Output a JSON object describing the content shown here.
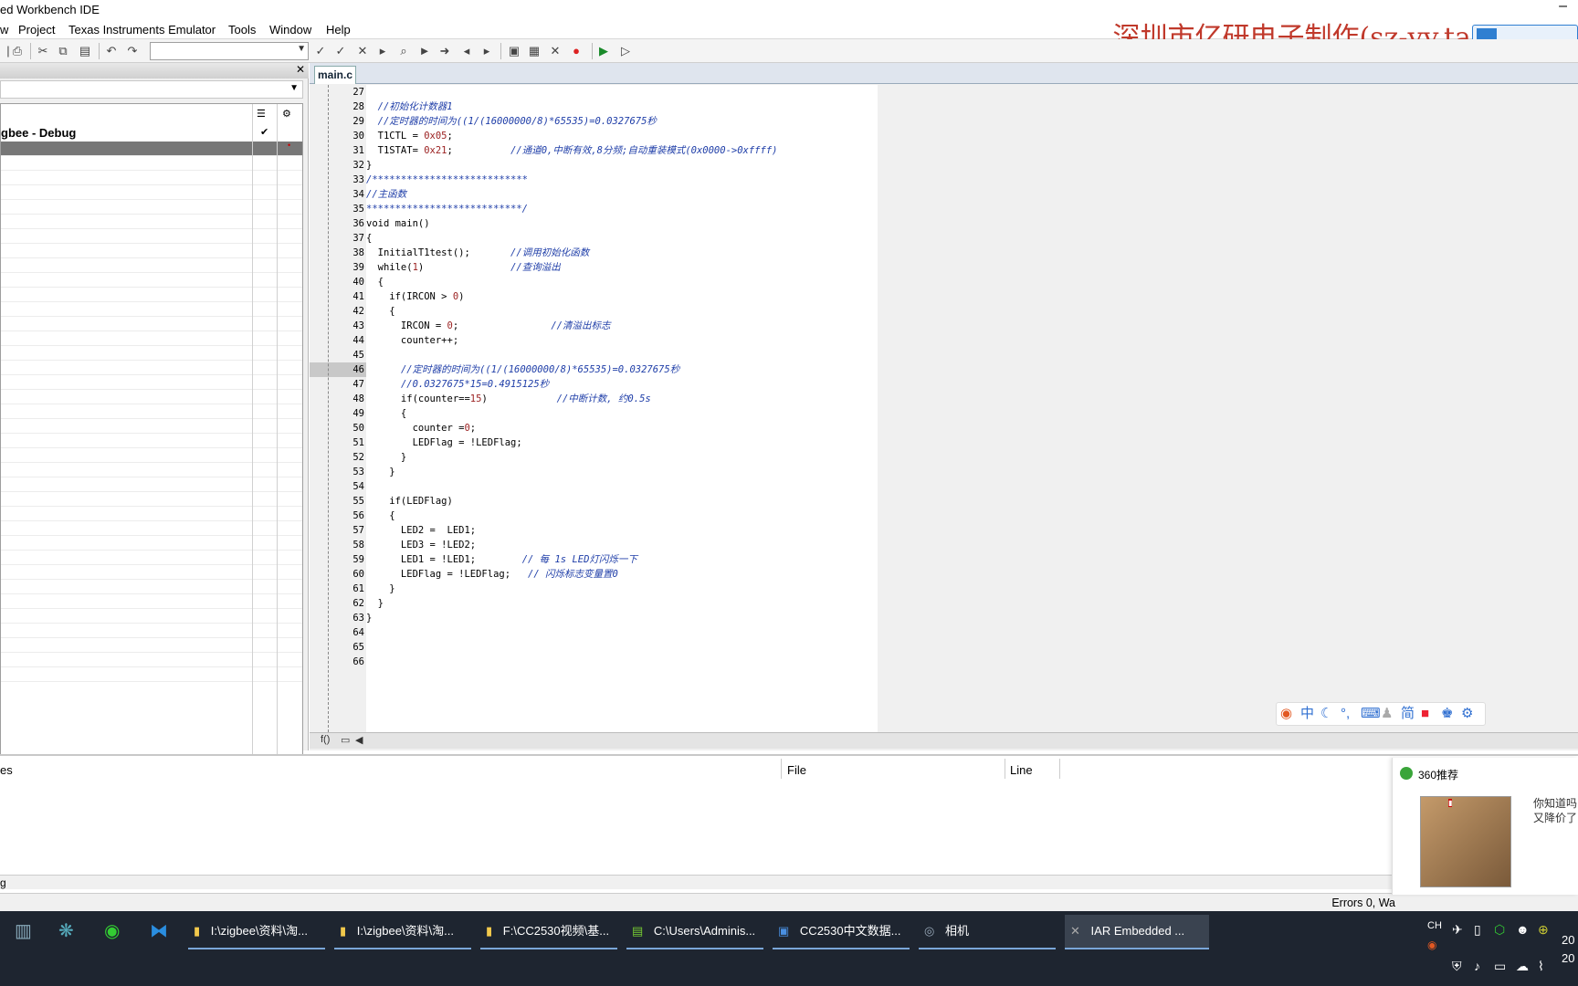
{
  "window": {
    "title": "ed Workbench IDE"
  },
  "menu": [
    "w",
    "Project",
    "Texas Instruments Emulator",
    "Tools",
    "Window",
    "Help"
  ],
  "watermark": "深圳市亿研电子制作(sz-yy.taobao.co",
  "workspace": {
    "project": "gbee - Debug",
    "check": "✔"
  },
  "editor": {
    "tab": "main.c",
    "lines": [
      {
        "n": "27",
        "code": ""
      },
      {
        "n": "28",
        "code": "  //初始化计数器1"
      },
      {
        "n": "29",
        "code": "  //定时器的时间为((1/(16000000/8)*65535)=0.0327675秒"
      },
      {
        "n": "30",
        "code": "  T1CTL = 0x05;"
      },
      {
        "n": "31",
        "code": "  T1STAT= 0x21;          //通道0,中断有效,8分频;自动重装模式(0x0000->0xffff)"
      },
      {
        "n": "32",
        "code": "}"
      },
      {
        "n": "33",
        "code": "/***************************"
      },
      {
        "n": "34",
        "code": "//主函数"
      },
      {
        "n": "35",
        "code": "***************************/"
      },
      {
        "n": "36",
        "code": "void main()"
      },
      {
        "n": "37",
        "code": "{"
      },
      {
        "n": "38",
        "code": "  InitialT1test();       //调用初始化函数"
      },
      {
        "n": "39",
        "code": "  while(1)               //查询溢出"
      },
      {
        "n": "40",
        "code": "  {"
      },
      {
        "n": "41",
        "code": "    if(IRCON > 0)"
      },
      {
        "n": "42",
        "code": "    {"
      },
      {
        "n": "43",
        "code": "      IRCON = 0;                //清溢出标志"
      },
      {
        "n": "44",
        "code": "      counter++;"
      },
      {
        "n": "45",
        "code": ""
      },
      {
        "n": "46",
        "code": "      //定时器的时间为((1/(16000000/8)*65535)=0.0327675秒"
      },
      {
        "n": "47",
        "code": "      //0.0327675*15=0.4915125秒"
      },
      {
        "n": "48",
        "code": "      if(counter==15)            //中断计数, 约0.5s"
      },
      {
        "n": "49",
        "code": "      {"
      },
      {
        "n": "50",
        "code": "        counter =0;"
      },
      {
        "n": "51",
        "code": "        LEDFlag = !LEDFlag;"
      },
      {
        "n": "52",
        "code": "      }"
      },
      {
        "n": "53",
        "code": "    }"
      },
      {
        "n": "54",
        "code": ""
      },
      {
        "n": "55",
        "code": "    if(LEDFlag)"
      },
      {
        "n": "56",
        "code": "    {"
      },
      {
        "n": "57",
        "code": "      LED2 =  LED1;"
      },
      {
        "n": "58",
        "code": "      LED3 = !LED2;"
      },
      {
        "n": "59",
        "code": "      LED1 = !LED1;        // 每 1s LED灯闪烁一下"
      },
      {
        "n": "60",
        "code": "      LEDFlag = !LEDFlag;   // 闪烁标志变量置0"
      },
      {
        "n": "61",
        "code": "    }"
      },
      {
        "n": "62",
        "code": "  }"
      },
      {
        "n": "63",
        "code": "}"
      },
      {
        "n": "64",
        "code": ""
      },
      {
        "n": "65",
        "code": ""
      },
      {
        "n": "66",
        "code": ""
      }
    ]
  },
  "output": {
    "col_messages": "es",
    "col_file": "File",
    "col_line": "Line",
    "tab": "g"
  },
  "status": {
    "text": "Errors 0, Wa"
  },
  "popup": {
    "title": "360推荐",
    "text1": "你知道吗",
    "text2": "又降价了"
  },
  "taskbar": [
    {
      "label": "I:\\zigbee\\资料\\淘..."
    },
    {
      "label": "I:\\zigbee\\资料\\淘..."
    },
    {
      "label": "F:\\CC2530视频\\基..."
    },
    {
      "label": "C:\\Users\\Adminis..."
    },
    {
      "label": "CC2530中文数据..."
    },
    {
      "label": "相机"
    },
    {
      "label": "IAR Embedded ..."
    }
  ],
  "tray": {
    "lang": "CH",
    "clock1": "20",
    "clock2": "20"
  },
  "ime": {
    "zh": "中",
    "jian": "简"
  }
}
